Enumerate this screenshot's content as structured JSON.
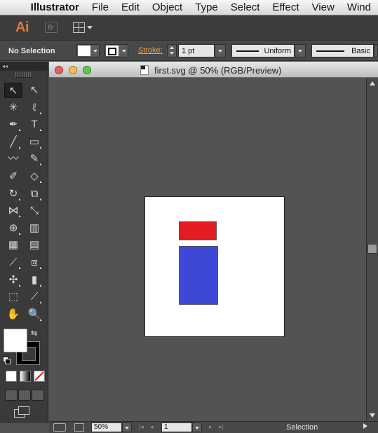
{
  "menubar": {
    "apple_glyph": "",
    "items": [
      "Illustrator",
      "File",
      "Edit",
      "Object",
      "Type",
      "Select",
      "Effect",
      "View",
      "Wind"
    ]
  },
  "appbar": {
    "logo": "Ai",
    "bridge_label": "Br"
  },
  "controlbar": {
    "selection_label": "No Selection",
    "stroke_label": "Stroke:",
    "stroke_weight": "1 pt",
    "profile_label": "Uniform",
    "brush_label": "Basic"
  },
  "tools": {
    "icons": [
      [
        "selection-tool",
        "direct-selection-tool"
      ],
      [
        "magic-wand-tool",
        "lasso-tool"
      ],
      [
        "pen-tool",
        "type-tool"
      ],
      [
        "line-segment-tool",
        "rectangle-tool"
      ],
      [
        "paintbrush-tool",
        "pencil-tool"
      ],
      [
        "blob-brush-tool",
        "eraser-tool"
      ],
      [
        "rotate-tool",
        "scale-tool"
      ],
      [
        "width-tool",
        "free-transform-tool"
      ],
      [
        "shape-builder-tool",
        "perspective-grid-tool"
      ],
      [
        "mesh-tool",
        "gradient-tool"
      ],
      [
        "eyedropper-tool",
        "blend-tool"
      ],
      [
        "symbol-sprayer-tool",
        "column-graph-tool"
      ],
      [
        "artboard-tool",
        "slice-tool"
      ],
      [
        "hand-tool",
        "zoom-tool"
      ]
    ],
    "glyphs": [
      [
        "↖",
        "↖"
      ],
      [
        "✳",
        "ℓ"
      ],
      [
        "✒",
        "T"
      ],
      [
        "╱",
        "▭"
      ],
      [
        "〰",
        "✎"
      ],
      [
        "✐",
        "◇"
      ],
      [
        "↻",
        "⧉"
      ],
      [
        "⋈",
        "⤡"
      ],
      [
        "⊕",
        "▥"
      ],
      [
        "▦",
        "▤"
      ],
      [
        "⟋",
        "⧈"
      ],
      [
        "✣",
        "▮"
      ],
      [
        "⬚",
        "⟋"
      ],
      [
        "✋",
        "🔍"
      ]
    ],
    "swap_glyph": "⇆"
  },
  "document": {
    "title": "first.svg @ 50% (RGB/Preview)",
    "zoom": "50%",
    "artboard_number": "1",
    "status": "Selection",
    "shape_colors": {
      "red": "#e31b23",
      "blue": "#3f48d6"
    },
    "traffic_colors": {
      "close": "#ec5d57",
      "minimize": "#f5bf4f",
      "zoom": "#61c554"
    }
  }
}
